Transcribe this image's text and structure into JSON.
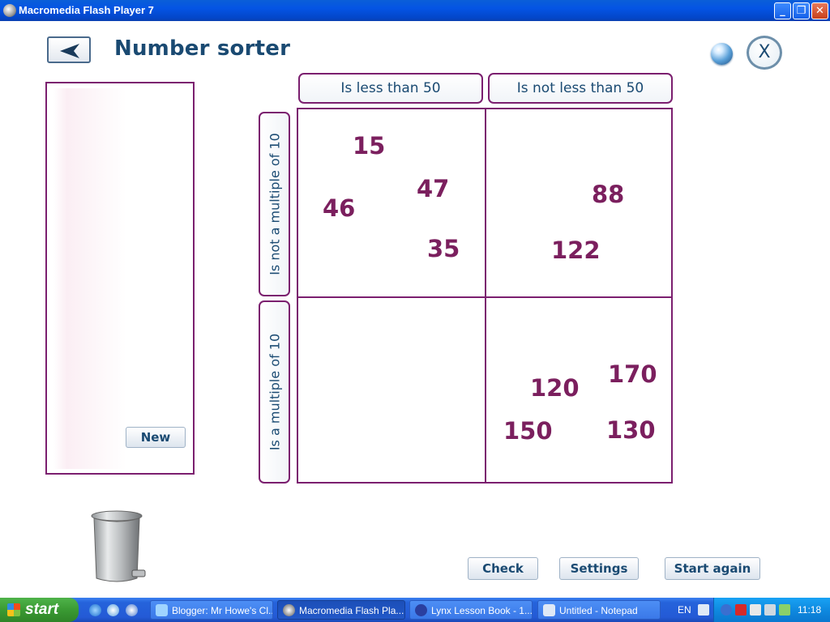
{
  "window": {
    "title": "Macromedia Flash Player 7",
    "controls": {
      "minimize": "_",
      "maximize": "❐",
      "close": "✕"
    }
  },
  "app": {
    "title": "Number sorter",
    "close_label": "X",
    "new_label": "New",
    "columns": [
      "Is less than 50",
      "Is not less than 50"
    ],
    "rows": [
      "Is not a multiple of 10",
      "Is a multiple of 10"
    ],
    "cells": {
      "top_left": [
        "15",
        "47",
        "46",
        "35"
      ],
      "top_right": [
        "88",
        "122"
      ],
      "bottom_left": [],
      "bottom_right": [
        "170",
        "120",
        "150",
        "130"
      ]
    },
    "buttons": {
      "check": "Check",
      "settings": "Settings",
      "start_again": "Start again"
    }
  },
  "taskbar": {
    "start_label": "start",
    "tasks": [
      {
        "label": "Blogger: Mr Howe's Cl...",
        "icon": "ie-icon",
        "active": false
      },
      {
        "label": "Macromedia Flash Pla...",
        "icon": "flash-icon",
        "active": true
      },
      {
        "label": "Lynx Lesson Book - 1...",
        "icon": "lynx-icon",
        "active": false
      },
      {
        "label": "Untitled - Notepad",
        "icon": "notepad-icon",
        "active": false
      }
    ],
    "language": "EN",
    "clock": "11:18"
  },
  "colors": {
    "accent": "#7b1f6f",
    "number": "#7b1f5e",
    "label": "#1a4a72"
  }
}
